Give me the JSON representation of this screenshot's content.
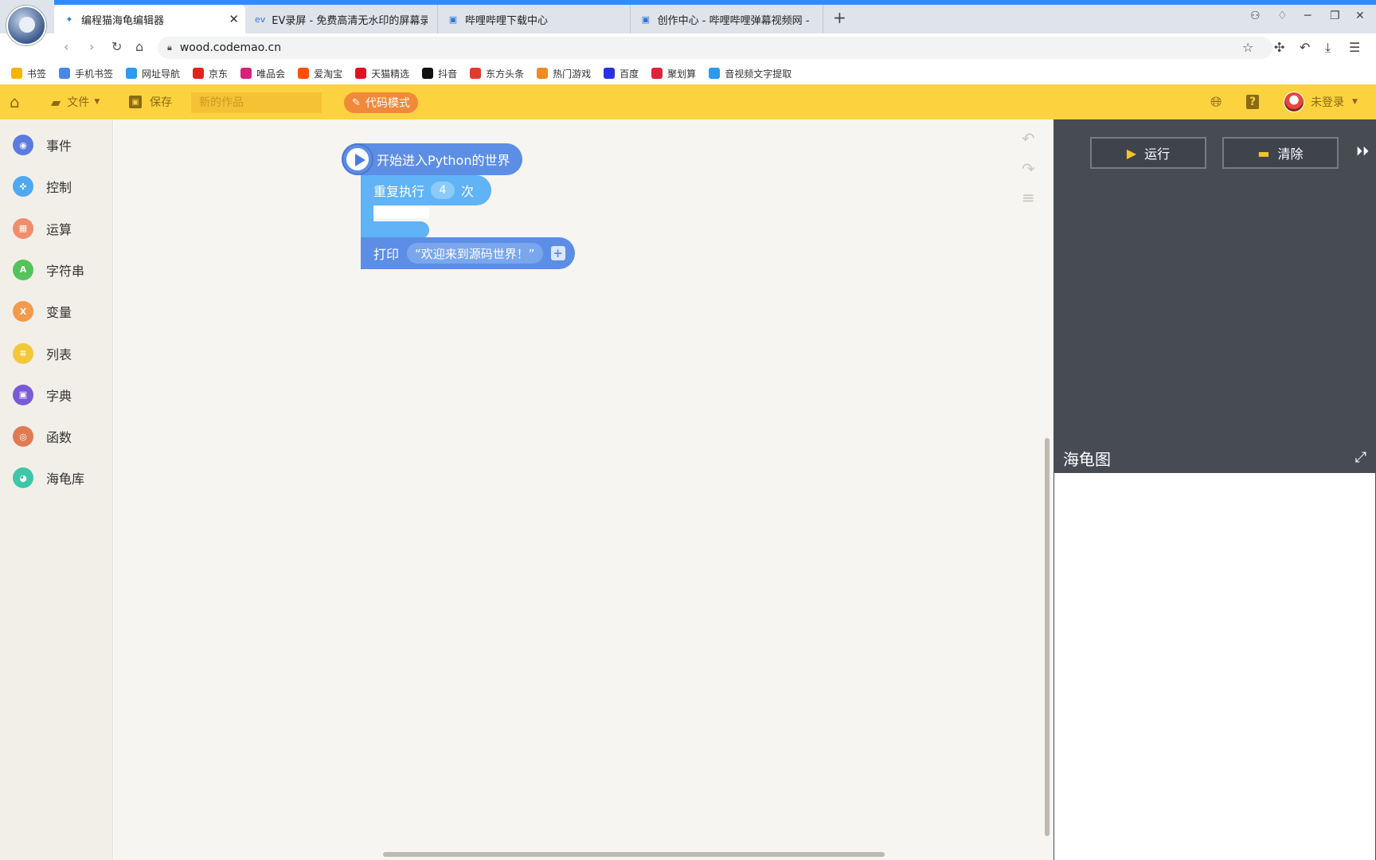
{
  "browser": {
    "tabs": [
      {
        "label": "编程猫海龟编辑器",
        "active": true
      },
      {
        "label": "EV录屏 - 免费高清无水印的屏幕录制",
        "active": false
      },
      {
        "label": "哔哩哔哩下载中心",
        "active": false
      },
      {
        "label": "创作中心 - 哔哩哔哩弹幕视频网 - (",
        "active": false
      }
    ],
    "url": "wood.codemao.cn",
    "bookmarks": [
      {
        "label": "书签",
        "color": "#f5b400"
      },
      {
        "label": "手机书签",
        "color": "#4a86e8"
      },
      {
        "label": "网址导航",
        "color": "#2b9af3"
      },
      {
        "label": "京东",
        "color": "#e1251b"
      },
      {
        "label": "唯品会",
        "color": "#d6247b"
      },
      {
        "label": "爱淘宝",
        "color": "#ff5000"
      },
      {
        "label": "天猫精选",
        "color": "#e01222"
      },
      {
        "label": "抖音",
        "color": "#111111"
      },
      {
        "label": "东方头条",
        "color": "#e23b2e"
      },
      {
        "label": "热门游戏",
        "color": "#f08a24"
      },
      {
        "label": "百度",
        "color": "#2932e1"
      },
      {
        "label": "聚划算",
        "color": "#e0223a"
      },
      {
        "label": "音视频文字提取",
        "color": "#2b9af3"
      }
    ]
  },
  "toolbar": {
    "file_label": "文件",
    "save_label": "保存",
    "title_placeholder": "新的作品",
    "code_mode_label": "代码模式",
    "user_label": "未登录",
    "accent": "#fdd23f"
  },
  "sidebar": {
    "items": [
      {
        "label": "事件",
        "color": "#5b7be0",
        "glyph": "◉"
      },
      {
        "label": "控制",
        "color": "#4ea9f0",
        "glyph": "✜"
      },
      {
        "label": "运算",
        "color": "#f08d6b",
        "glyph": "▦"
      },
      {
        "label": "字符串",
        "color": "#54c45a",
        "glyph": "A"
      },
      {
        "label": "变量",
        "color": "#f39a4a",
        "glyph": "X"
      },
      {
        "label": "列表",
        "color": "#f3c73a",
        "glyph": "≡"
      },
      {
        "label": "字典",
        "color": "#7a5bd6",
        "glyph": "▣"
      },
      {
        "label": "函数",
        "color": "#e07a52",
        "glyph": "◎"
      },
      {
        "label": "海龟库",
        "color": "#3cc8a8",
        "glyph": "◕"
      }
    ]
  },
  "blocks": {
    "start_label": "开始进入Python的世界",
    "repeat_prefix": "重复执行",
    "repeat_count": "4",
    "repeat_suffix": "次",
    "print_label": "打印",
    "print_string": "“欢迎来到源码世界！”"
  },
  "right_panel": {
    "run_label": "运行",
    "clear_label": "清除",
    "turtle_title": "海龟图"
  }
}
